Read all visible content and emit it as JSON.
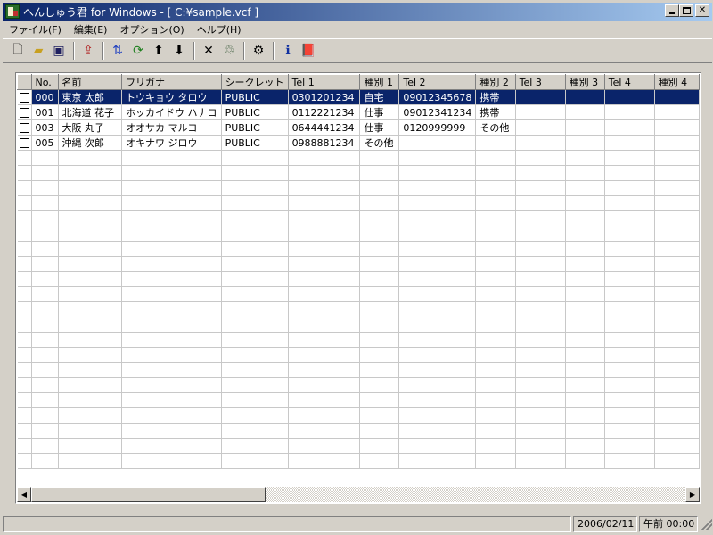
{
  "window": {
    "title": "へんしゅう君 for Windows - [ C:¥sample.vcf ]"
  },
  "menu": {
    "items": [
      "ファイル(F)",
      "編集(E)",
      "オプション(O)",
      "ヘルプ(H)"
    ]
  },
  "toolbar": {
    "icons": [
      "new-file-icon",
      "open-folder-icon",
      "save-icon",
      "export-icon",
      "sort-icon",
      "refresh-icon",
      "move-up-icon",
      "move-down-icon",
      "delete-icon",
      "recycle-icon",
      "properties-icon",
      "info-icon",
      "book-icon"
    ]
  },
  "grid": {
    "columns": [
      "",
      "No.",
      "名前",
      "フリガナ",
      "シークレット",
      "Tel 1",
      "種別 1",
      "Tel 2",
      "種別 2",
      "Tel 3",
      "種別 3",
      "Tel 4",
      "種別 4"
    ],
    "rows": [
      {
        "no": "000",
        "name": "東京 太郎",
        "kana": "トウキョウ タロウ",
        "secret": "PUBLIC",
        "tel1": "0301201234",
        "kind1": "自宅",
        "tel2": "09012345678",
        "kind2": "携帯",
        "tel3": "",
        "kind3": "",
        "tel4": "",
        "kind4": "",
        "selected": true
      },
      {
        "no": "001",
        "name": "北海道 花子",
        "kana": "ホッカイドウ ハナコ",
        "secret": "PUBLIC",
        "tel1": "0112221234",
        "kind1": "仕事",
        "tel2": "09012341234",
        "kind2": "携帯",
        "tel3": "",
        "kind3": "",
        "tel4": "",
        "kind4": "",
        "selected": false
      },
      {
        "no": "003",
        "name": "大阪 丸子",
        "kana": "オオサカ マルコ",
        "secret": "PUBLIC",
        "tel1": "0644441234",
        "kind1": "仕事",
        "tel2": "0120999999",
        "kind2": "その他",
        "tel3": "",
        "kind3": "",
        "tel4": "",
        "kind4": "",
        "selected": false
      },
      {
        "no": "005",
        "name": "沖縄 次郎",
        "kana": "オキナワ ジロウ",
        "secret": "PUBLIC",
        "tel1": "0988881234",
        "kind1": "その他",
        "tel2": "",
        "kind2": "",
        "tel3": "",
        "kind3": "",
        "tel4": "",
        "kind4": "",
        "selected": false
      }
    ],
    "empty_rows": 21
  },
  "statusbar": {
    "main": "",
    "date": "2006/02/11",
    "time": "午前 00:00"
  },
  "colors": {
    "selection": "#0a246a",
    "titlebar_start": "#0a246a",
    "titlebar_end": "#a6caf0",
    "face": "#d4d0c8"
  }
}
